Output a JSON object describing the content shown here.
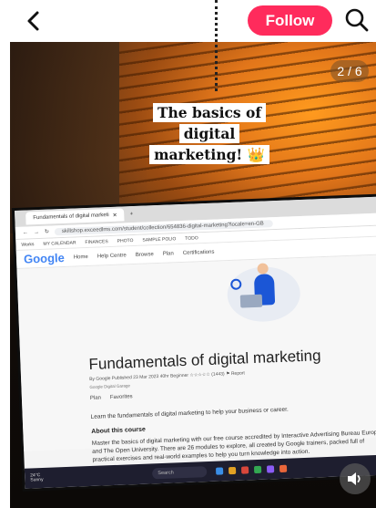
{
  "topbar": {
    "back_icon": "chevron-left-icon",
    "follow_label": "Follow",
    "search_icon": "search-icon",
    "follow_color": "#ff2b5c"
  },
  "post": {
    "page_counter": "2 / 6",
    "caption_line1": "The basics of digital",
    "caption_line2": "marketing! 👑",
    "sound_icon": "speaker-icon"
  },
  "screen": {
    "tab_title": "Fundamentals of digital marketi",
    "url": "skillshop.exceedlms.com/student/collection/654836-digital-marketing?locale=en-GB",
    "bookmarks": [
      "Works",
      "MY CALENDAR",
      "FINANCES",
      "PHOTO",
      "SAMPLE POLIO",
      "TODO"
    ],
    "logo": "Google",
    "nav": [
      "Home",
      "Help Centre",
      "Browse",
      "Plan",
      "Certifications"
    ],
    "course_title": "Fundamentals of digital marketing",
    "meta": "By Google  Published 23 Mar 2023  40hr  Beginner  ☆☆☆☆☆ (1443)  ⚑ Report",
    "provider": "Google Digital Garage",
    "actions": [
      "Plan",
      "Favorites"
    ],
    "learn_text": "Learn the fundamentals of digital marketing to help your business or career.",
    "about_heading": "About this course",
    "about_text": "Master the basics of digital marketing with our free course accredited by Interactive Advertising Bureau Europe and The Open University. There are 26 modules to explore, all created by Google trainers, packed full of practical exercises and real-world examples to help you turn knowledge into action.",
    "weather_temp": "24°C",
    "weather_desc": "Sunny",
    "taskbar_search": "Search"
  }
}
